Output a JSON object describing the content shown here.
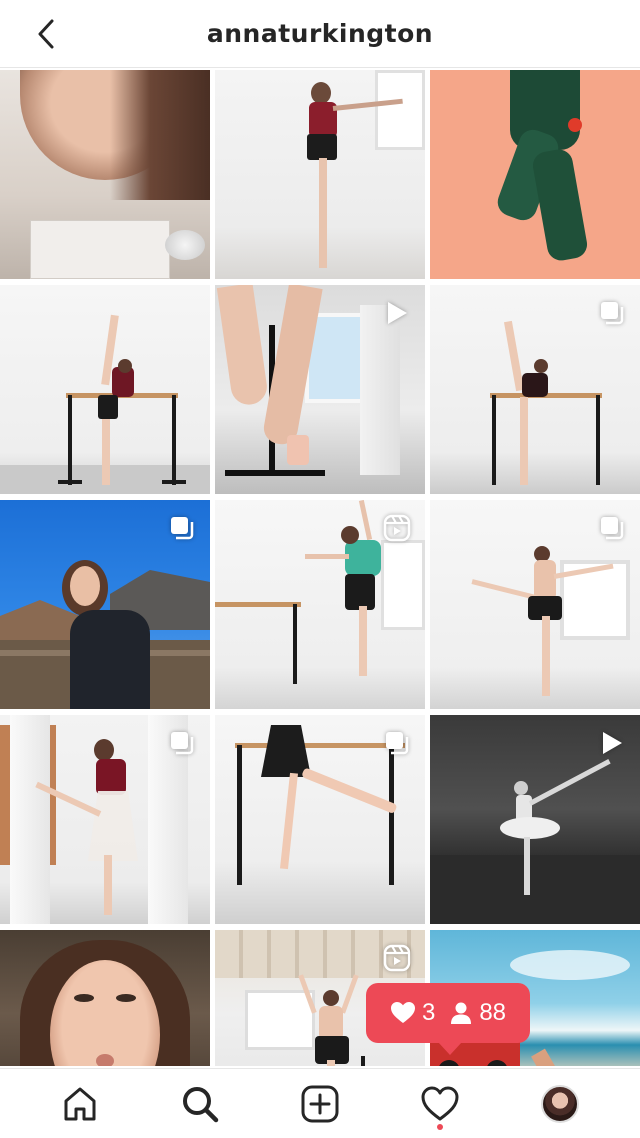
{
  "header": {
    "title": "annaturkington"
  },
  "notification": {
    "likes": "3",
    "followers": "88"
  },
  "grid": {
    "badges": {
      "r1c1": "",
      "r1c2": "",
      "r1c3": "",
      "r2c2": "video",
      "r2c3": "carousel",
      "r3c1": "carousel",
      "r3c2": "reel",
      "r3c3": "carousel",
      "r4c1": "carousel",
      "r4c2": "carousel",
      "r4c3": "video",
      "r5c2": "reel"
    }
  },
  "nav": {
    "items": [
      "home-icon",
      "search-icon",
      "new-post-icon",
      "activity-icon",
      "profile-avatar"
    ]
  },
  "colors": {
    "accent": "#ed4956",
    "text": "#262626",
    "divider": "#e6e6e6"
  }
}
